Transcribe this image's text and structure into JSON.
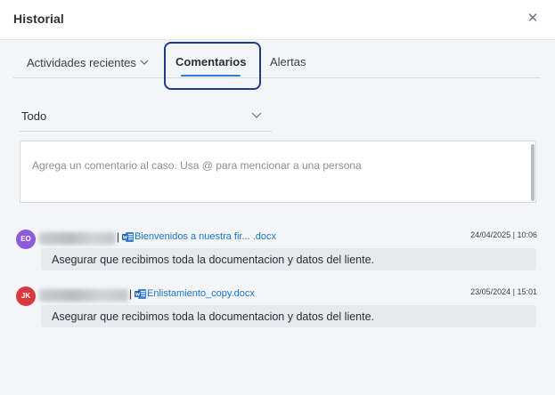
{
  "dialog": {
    "title": "Historial",
    "close_glyph": "✕"
  },
  "tabs": {
    "activities": {
      "label": "Actividades recientes",
      "chevron": "chevron-down-icon"
    },
    "comments": {
      "label": "Comentarios",
      "active": true
    },
    "alerts": {
      "label": "Alertas"
    }
  },
  "filter": {
    "selected": "Todo",
    "icon": "chevron-down-icon"
  },
  "comment_input": {
    "placeholder": "Agrega un comentario al caso. Usa @ para mencionar a una persona"
  },
  "comments": [
    {
      "initials": "EO",
      "avatar_color": "#8e5bd8",
      "author_blurred": true,
      "separator": "|",
      "attachment": "Bienvenidos a nuestra fir... .docx",
      "attachment_icon": "word-doc-icon",
      "datetime": "24/04/2025 | 10:06",
      "text": "Asegurar que recibimos toda la documentacion y datos del liente."
    },
    {
      "initials": "JK",
      "avatar_color": "#d63a40",
      "author_blurred": true,
      "separator": "|",
      "attachment": "Enlistamiento_copy.docx",
      "attachment_icon": "word-doc-icon",
      "datetime": "23/05/2024 | 15:01",
      "text": "Asegurar que recibimos toda la documentacion y datos del liente."
    }
  ],
  "colors": {
    "accent": "#2f7cd1",
    "link": "#1a73c8",
    "focus_ring": "#1e3a8a"
  }
}
